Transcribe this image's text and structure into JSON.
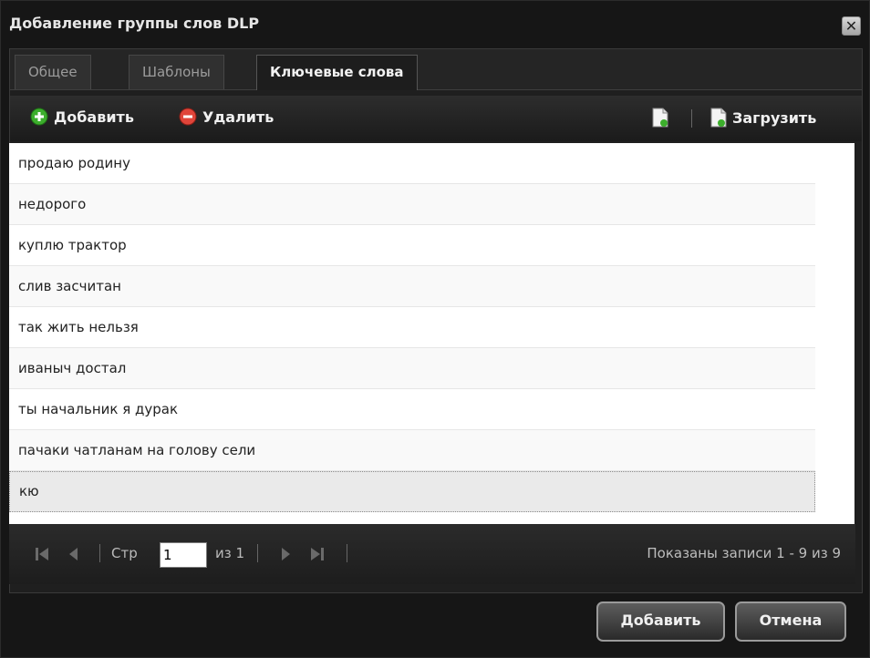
{
  "window": {
    "title": "Добавление группы слов DLP",
    "close_symbol": "✕"
  },
  "tabs": [
    {
      "label": "Общее",
      "active": false
    },
    {
      "label": "Шаблоны",
      "active": false
    },
    {
      "label": "Ключевые слова",
      "active": true
    }
  ],
  "toolbar": {
    "add_label": "Добавить",
    "delete_label": "Удалить",
    "load_label": "Загрузить",
    "add_icon": "green-plus-icon",
    "delete_icon": "red-minus-icon",
    "export_icon": "document-arrow-icon",
    "load_icon": "document-download-icon"
  },
  "grid": {
    "rows": [
      "продаю родину",
      "недорого",
      "куплю трактор",
      "слив засчитан",
      "так жить нельзя",
      "иваныч достал",
      "ты начальник я дурак",
      "пачаки чатланам на голову сели",
      "кю"
    ],
    "selected_index": 8
  },
  "pager": {
    "page_label": "Стр",
    "page_value": "1",
    "of_label": "из 1",
    "info": "Показаны записи 1 - 9 из 9"
  },
  "footer": {
    "add_label": "Добавить",
    "cancel_label": "Отмена"
  },
  "colors": {
    "add_icon": "#3cae2c",
    "delete_icon": "#e0453a",
    "panel_bg": "#1f1f1f"
  }
}
